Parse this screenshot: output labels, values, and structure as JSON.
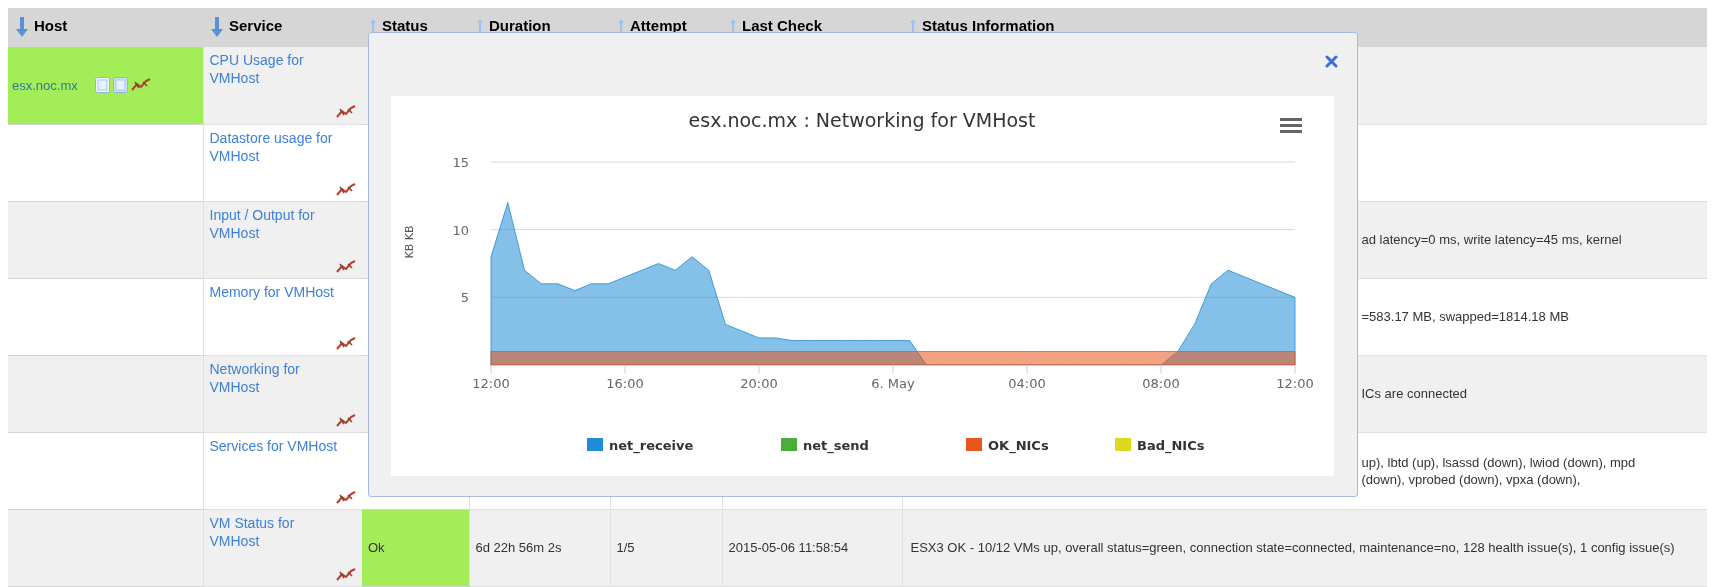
{
  "table": {
    "columns": [
      {
        "label": "Host",
        "sorted": true
      },
      {
        "label": "Service",
        "sorted": true
      },
      {
        "label": "Status",
        "sorted": false
      },
      {
        "label": "Duration",
        "sorted": false
      },
      {
        "label": "Attempt",
        "sorted": false
      },
      {
        "label": "Last Check",
        "sorted": false
      },
      {
        "label": "Status Information",
        "sorted": false
      }
    ],
    "rows": [
      {
        "host": {
          "name": "esx.noc.mx",
          "color": "#a3ee58"
        },
        "service": "CPU Usage for VMHost"
      },
      {
        "service": "Datastore usage for VMHost"
      },
      {
        "service": "Input / Output for VMHost",
        "status_information": "ad latency=0 ms, write latency=45 ms, kernel"
      },
      {
        "service": "Memory for VMHost",
        "status_information": "=583.17 MB, swapped=1814.18 MB"
      },
      {
        "service": "Networking for VMHost",
        "status_information": "ICs are connected"
      },
      {
        "service": "Services for VMHost",
        "status_information": "up), lbtd (up), lsassd (down), lwiod (down), mpd (down), vprobed (down), vpxa (down),"
      },
      {
        "service": "VM Status for VMHost",
        "status": {
          "label": "Ok",
          "color": "#a3ee58"
        },
        "duration": "6d 22h 56m 2s",
        "attempt": "1/5",
        "last_check": "2015-05-06 11:58:54",
        "status_information": "ESX3 OK - 10/12 VMs up, overall status=green, connection state=connected, maintenance=no, 128 health issue(s), 1 config issue(s)"
      }
    ]
  },
  "popup": {
    "chart_data": {
      "type": "area",
      "title": "esx.noc.mx : Networking for VMHost",
      "ylabel": "KB KB",
      "categories": [
        "12:00",
        null,
        null,
        null,
        null,
        null,
        null,
        null,
        "16:00",
        null,
        null,
        null,
        null,
        null,
        null,
        null,
        "20:00",
        null,
        null,
        null,
        null,
        null,
        null,
        null,
        "6. May",
        null,
        null,
        null,
        null,
        null,
        null,
        null,
        "04:00",
        null,
        null,
        null,
        null,
        null,
        null,
        null,
        "08:00",
        null,
        null,
        null,
        null,
        null,
        null,
        null,
        "12:00"
      ],
      "ylim": [
        0,
        15
      ],
      "legend": "bottom",
      "yticks": [
        5,
        10,
        15
      ],
      "series": [
        {
          "name": "net_receive",
          "color": "#1f8dd6",
          "values": [
            8,
            12,
            7,
            6,
            6,
            5.5,
            6,
            6,
            6.5,
            7,
            7.5,
            7,
            8,
            7,
            3,
            2.5,
            2,
            2,
            1.8,
            1.8,
            1.8,
            1.8,
            1.8,
            1.8,
            1.8,
            1.8,
            0,
            0,
            0,
            0,
            0,
            0,
            0,
            0,
            0,
            0,
            0,
            0,
            0,
            0,
            0,
            1,
            3,
            6,
            7,
            6.5,
            6,
            5.5,
            5
          ]
        },
        {
          "name": "net_send",
          "color": "#4cae3a",
          "values": [
            null,
            null,
            null,
            null,
            null,
            null,
            null,
            null,
            null,
            null,
            null,
            null,
            null,
            null,
            null,
            null,
            null,
            null,
            null,
            null,
            null,
            null,
            null,
            null,
            null,
            null,
            null,
            null,
            null,
            null,
            null,
            null,
            null,
            null,
            null,
            null,
            null,
            null,
            null,
            null,
            null,
            null,
            null,
            null,
            null,
            null,
            null,
            null,
            null
          ]
        },
        {
          "name": "OK_NICs",
          "color": "#e8561e",
          "values": [
            1,
            1,
            1,
            1,
            1,
            1,
            1,
            1,
            1,
            1,
            1,
            1,
            1,
            1,
            1,
            1,
            1,
            1,
            1,
            1,
            1,
            1,
            1,
            1,
            1,
            1,
            1,
            1,
            1,
            1,
            1,
            1,
            1,
            1,
            1,
            1,
            1,
            1,
            1,
            1,
            1,
            1,
            1,
            1,
            1,
            1,
            1,
            1,
            1
          ]
        },
        {
          "name": "Bad_NICs",
          "color": "#dcd91e",
          "values": [
            null,
            null,
            null,
            null,
            null,
            null,
            null,
            null,
            null,
            null,
            null,
            null,
            null,
            null,
            null,
            null,
            null,
            null,
            null,
            null,
            null,
            null,
            null,
            null,
            null,
            null,
            null,
            null,
            null,
            null,
            null,
            null,
            null,
            null,
            null,
            null,
            null,
            null,
            null,
            null,
            null,
            null,
            null,
            null,
            null,
            null,
            null,
            null,
            null
          ]
        }
      ]
    }
  }
}
